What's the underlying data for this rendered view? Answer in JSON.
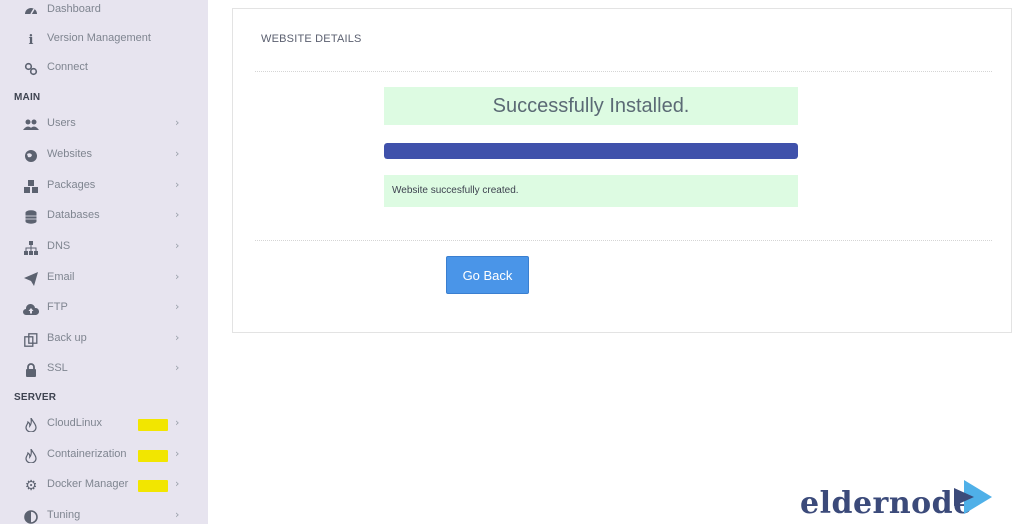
{
  "sidebar": {
    "top_items": [
      {
        "label": "Dashboard",
        "icon": "dashboard-icon"
      },
      {
        "label": "Version Management",
        "icon": "info-icon"
      },
      {
        "label": "Connect",
        "icon": "link-icon"
      }
    ],
    "main_title": "MAIN",
    "main_items": [
      {
        "label": "Users",
        "icon": "users-icon"
      },
      {
        "label": "Websites",
        "icon": "globe-icon"
      },
      {
        "label": "Packages",
        "icon": "cubes-icon"
      },
      {
        "label": "Databases",
        "icon": "database-icon"
      },
      {
        "label": "DNS",
        "icon": "sitemap-icon"
      },
      {
        "label": "Email",
        "icon": "paper-plane-icon"
      },
      {
        "label": "FTP",
        "icon": "cloud-upload-icon"
      },
      {
        "label": "Back up",
        "icon": "copy-icon"
      },
      {
        "label": "SSL",
        "icon": "lock-icon"
      }
    ],
    "server_title": "SERVER",
    "server_items": [
      {
        "label": "CloudLinux",
        "icon": "fire-icon"
      },
      {
        "label": "Containerization",
        "icon": "fire-icon"
      },
      {
        "label": "Docker Manager",
        "icon": "gears-icon"
      },
      {
        "label": "Tuning",
        "icon": "adjust-icon"
      }
    ],
    "chevron": "›"
  },
  "panel": {
    "title": "WEBSITE DETAILS",
    "success_message": "Successfully Installed.",
    "progress_percent": 100,
    "status_message": "Website succesfully created.",
    "go_back_label": "Go Back"
  },
  "logo": {
    "text": "eldernode"
  },
  "colors": {
    "sidebar_bg": "#e7e4ef",
    "success_bg": "#ddfbe2",
    "progress_fill": "#3f51ab",
    "button_bg": "#4a95e8",
    "highlight_badge": "#f2e600",
    "logo_blue": "#3b4a7a",
    "logo_accent": "#4fb0e8"
  }
}
